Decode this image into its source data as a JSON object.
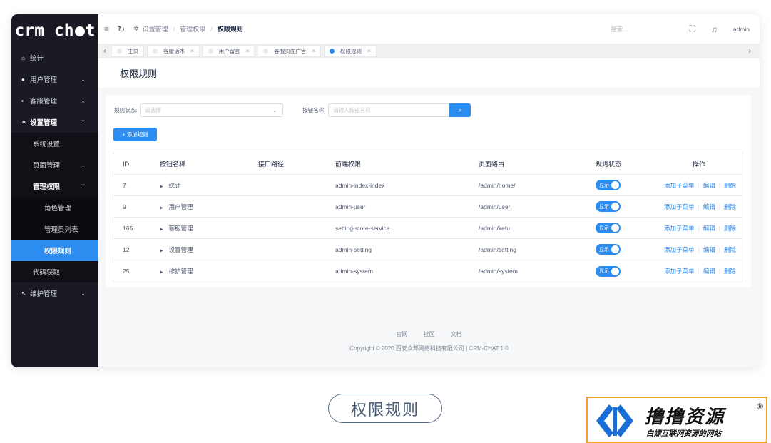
{
  "logo": {
    "text_left": "crm ch",
    "text_right": "t"
  },
  "sidebar": {
    "items": [
      {
        "label": "统计",
        "icon": "home-icon"
      },
      {
        "label": "用户管理",
        "icon": "user-icon"
      },
      {
        "label": "客服管理",
        "icon": "chat-icon"
      },
      {
        "label": "设置管理",
        "icon": "gear-icon"
      },
      {
        "label": "系统设置"
      },
      {
        "label": "页面管理"
      },
      {
        "label": "管理权限"
      },
      {
        "label": "角色管理"
      },
      {
        "label": "管理员列表"
      },
      {
        "label": "权限规则"
      },
      {
        "label": "代码获取"
      },
      {
        "label": "维护管理",
        "icon": "wrench-icon"
      }
    ]
  },
  "topbar": {
    "breadcrumb": [
      "设置管理",
      "管理权限",
      "权限规则"
    ],
    "search_placeholder": "搜索...",
    "user": "admin"
  },
  "tabs": [
    {
      "label": "主页",
      "closable": false
    },
    {
      "label": "客服话术",
      "closable": true
    },
    {
      "label": "用户留言",
      "closable": true
    },
    {
      "label": "客服页面广告",
      "closable": true
    },
    {
      "label": "权限规则",
      "closable": true,
      "active": true
    }
  ],
  "page": {
    "title": "权限规则"
  },
  "filter": {
    "status_label": "规则状态:",
    "status_placeholder": "请选择",
    "name_label": "按钮名称:",
    "name_placeholder": "请输入按钮名称",
    "add_button": "+ 添加规则"
  },
  "table": {
    "headers": [
      "ID",
      "按钮名称",
      "接口路径",
      "前端权限",
      "页面路由",
      "规则状态",
      "操作"
    ],
    "rows": [
      {
        "id": "7",
        "name": "统计",
        "path": "",
        "front": "admin-index-index",
        "route": "/admin/home/",
        "status": "显示"
      },
      {
        "id": "9",
        "name": "用户管理",
        "path": "",
        "front": "admin-user",
        "route": "/admin/user",
        "status": "显示"
      },
      {
        "id": "165",
        "name": "客服管理",
        "path": "",
        "front": "setting-store-service",
        "route": "/admin/kefu",
        "status": "显示"
      },
      {
        "id": "12",
        "name": "设置管理",
        "path": "",
        "front": "admin-setting",
        "route": "/admin/setting",
        "status": "显示"
      },
      {
        "id": "25",
        "name": "维护管理",
        "path": "",
        "front": "admin-system",
        "route": "/admin/system",
        "status": "显示"
      }
    ],
    "ops": {
      "add_child": "添加子菜单",
      "edit": "编辑",
      "delete": "删除"
    }
  },
  "footer": {
    "links": [
      "官网",
      "社区",
      "文档"
    ],
    "copyright": "Copyright © 2020 西安众邦网络科技有限公司 | CRM-CHAT 1.0"
  },
  "caption": "权限规则",
  "watermark": {
    "title": "撸撸资源",
    "reg": "®",
    "subtitle": "白嫖互联网资源的网站"
  },
  "colors": {
    "primary": "#2d8cf0",
    "sidebar_bg": "#191a23"
  }
}
